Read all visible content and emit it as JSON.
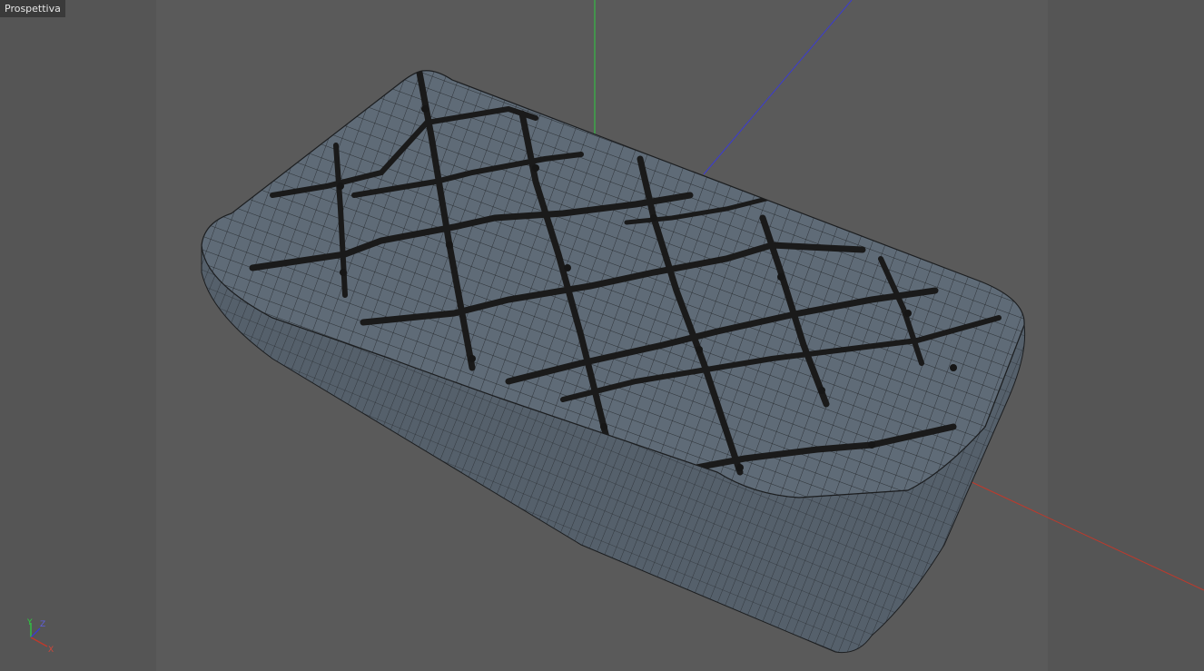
{
  "viewport": {
    "view_name": "Prospettiva",
    "colors": {
      "background": "#555555",
      "safe_frame": "#5a5a5a",
      "label_bg": "#3a3a3a",
      "mesh_fill": "#5f6b77",
      "wire": "#1c1e20",
      "axis_x": "#c0392b",
      "axis_y": "#2ecc40",
      "axis_z": "#3b3bd1"
    }
  },
  "gizmo": {
    "x_label": "X",
    "y_label": "Y",
    "z_label": "Z"
  }
}
